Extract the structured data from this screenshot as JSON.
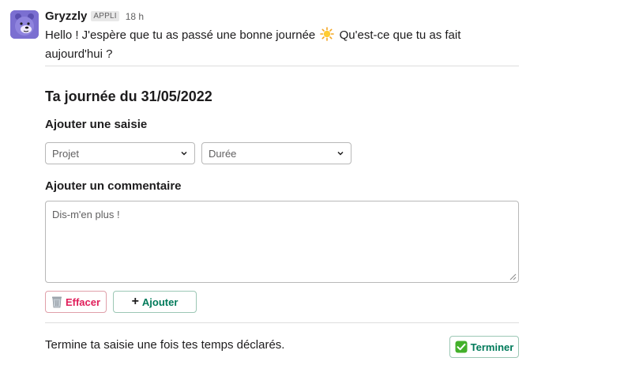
{
  "message": {
    "sender": "Gryzzly",
    "badge": "APPLI",
    "time": "18 h",
    "text_before": "Hello ! J'espère que tu as passé une bonne journée",
    "text_after": "Qu'est-ce que tu as fait aujourd'hui ?"
  },
  "form": {
    "title": "Ta journée du 31/05/2022",
    "add_entry_label": "Ajouter une saisie",
    "project_select": "Projet",
    "duration_select": "Durée",
    "comment_label": "Ajouter un commentaire",
    "comment_placeholder": "Dis-m'en plus !",
    "clear_button": "Effacer",
    "add_button": "Ajouter"
  },
  "footer": {
    "text": "Termine ta saisie une fois tes temps déclarés.",
    "finish_button": "Terminer"
  },
  "colors": {
    "avatar_bg": "#7b6fd1",
    "danger": "#e01e5a",
    "primary": "#007a5a"
  },
  "icons": {
    "avatar": "bear-mascot-icon",
    "sun": "sun-emoji-icon",
    "chevron": "chevron-down-icon",
    "trash": "wastebasket-icon",
    "plus": "plus-icon",
    "check": "check-mark-button-icon"
  }
}
